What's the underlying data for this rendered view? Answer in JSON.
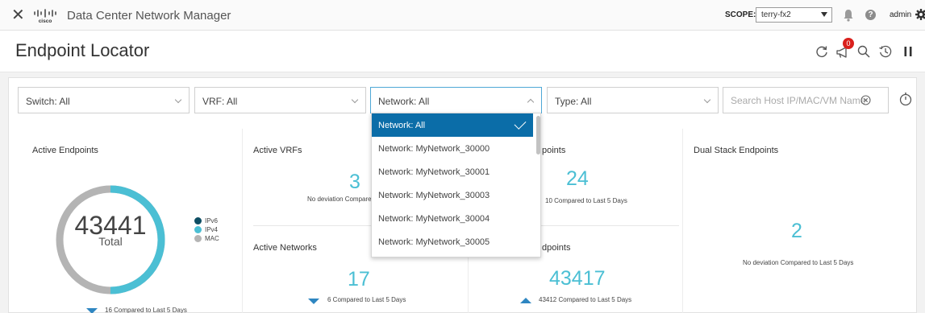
{
  "header": {
    "app_title": "Data Center Network Manager",
    "scope_label": "SCOPE:",
    "scope_value": "terry-fx2",
    "user": "admin"
  },
  "page": {
    "title": "Endpoint Locator",
    "notification_count": "0"
  },
  "filters": {
    "switch": "Switch: All",
    "vrf": "VRF: All",
    "network": "Network: All",
    "type": "Type: All",
    "search_placeholder": "Search Host IP/MAC/VM Name"
  },
  "dropdown": {
    "options": [
      "Network: All",
      "Network: MyNetwork_30000",
      "Network: MyNetwork_30001",
      "Network: MyNetwork_30003",
      "Network: MyNetwork_30004",
      "Network: MyNetwork_30005"
    ],
    "selected": "Network: All"
  },
  "cards": {
    "active_endpoints": {
      "title": "Active Endpoints",
      "total": "43441",
      "total_label": "Total",
      "legend": [
        "IPv6",
        "IPv4",
        "MAC"
      ],
      "caption": "16 Compared to Last 5 Days"
    },
    "active_vrfs": {
      "title": "Active VRFs",
      "value": "3",
      "caption": "No deviation Compared"
    },
    "active_networks": {
      "title": "Active Networks",
      "value": "17",
      "caption": "6 Compared to Last 5 Days"
    },
    "card_top_right": {
      "title": "points",
      "value": "24",
      "caption": "10 Compared to Last 5 Days"
    },
    "card_bottom_right": {
      "title": "dpoints",
      "value": "43417",
      "caption": "43412 Compared to Last 5 Days"
    },
    "dual_stack": {
      "title": "Dual Stack Endpoints",
      "value": "2",
      "caption": "No deviation Compared to Last 5 Days"
    }
  },
  "colors": {
    "accent": "#4bbfd4",
    "ipv6": "#0d4d63",
    "ipv4": "#4bbfd4",
    "mac": "#b4b4b4",
    "selected_bg": "#0b6da8",
    "trend": "#2e86c1",
    "badge": "#d9201c"
  },
  "icons": {
    "close": "close-icon",
    "logo": "cisco-logo",
    "bell": "bell-icon",
    "help": "help-icon",
    "settings": "gear-icon",
    "refresh": "refresh-icon",
    "announcement": "megaphone-icon",
    "search": "search-icon",
    "history": "history-icon",
    "pause": "pause-icon",
    "clear": "clear-icon",
    "timer": "timer-icon"
  }
}
